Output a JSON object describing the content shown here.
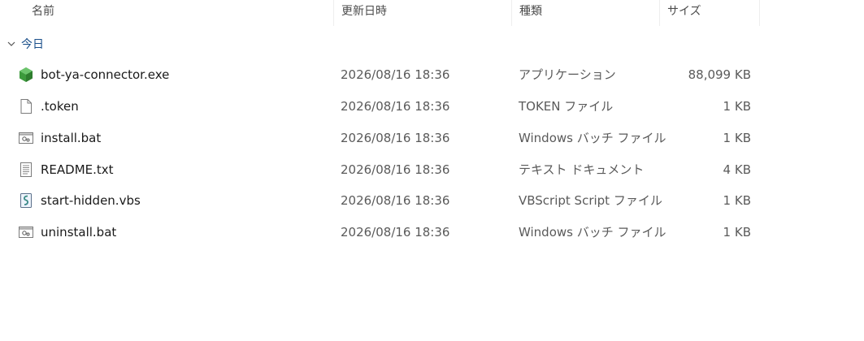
{
  "columns": {
    "name": "名前",
    "date": "更新日時",
    "type": "種類",
    "size": "サイズ"
  },
  "group": {
    "label": "今日",
    "icon": "chevron-down-icon"
  },
  "files": [
    {
      "name": "bot-ya-connector.exe",
      "date": "2026/08/16 18:36",
      "type": "アプリケーション",
      "size": "88,099 KB",
      "icon": "exe-icon"
    },
    {
      "name": ".token",
      "date": "2026/08/16 18:36",
      "type": "TOKEN ファイル",
      "size": "1 KB",
      "icon": "blank-file-icon"
    },
    {
      "name": "install.bat",
      "date": "2026/08/16 18:36",
      "type": "Windows バッチ ファイル",
      "size": "1 KB",
      "icon": "batch-file-icon"
    },
    {
      "name": "README.txt",
      "date": "2026/08/16 18:36",
      "type": "テキスト ドキュメント",
      "size": "4 KB",
      "icon": "text-file-icon"
    },
    {
      "name": "start-hidden.vbs",
      "date": "2026/08/16 18:36",
      "type": "VBScript Script ファイル",
      "size": "1 KB",
      "icon": "script-file-icon"
    },
    {
      "name": "uninstall.bat",
      "date": "2026/08/16 18:36",
      "type": "Windows バッチ ファイル",
      "size": "1 KB",
      "icon": "batch-file-icon"
    }
  ],
  "colors": {
    "group_label": "#1a4f8a",
    "exe_icon": "#3c9a3c"
  }
}
